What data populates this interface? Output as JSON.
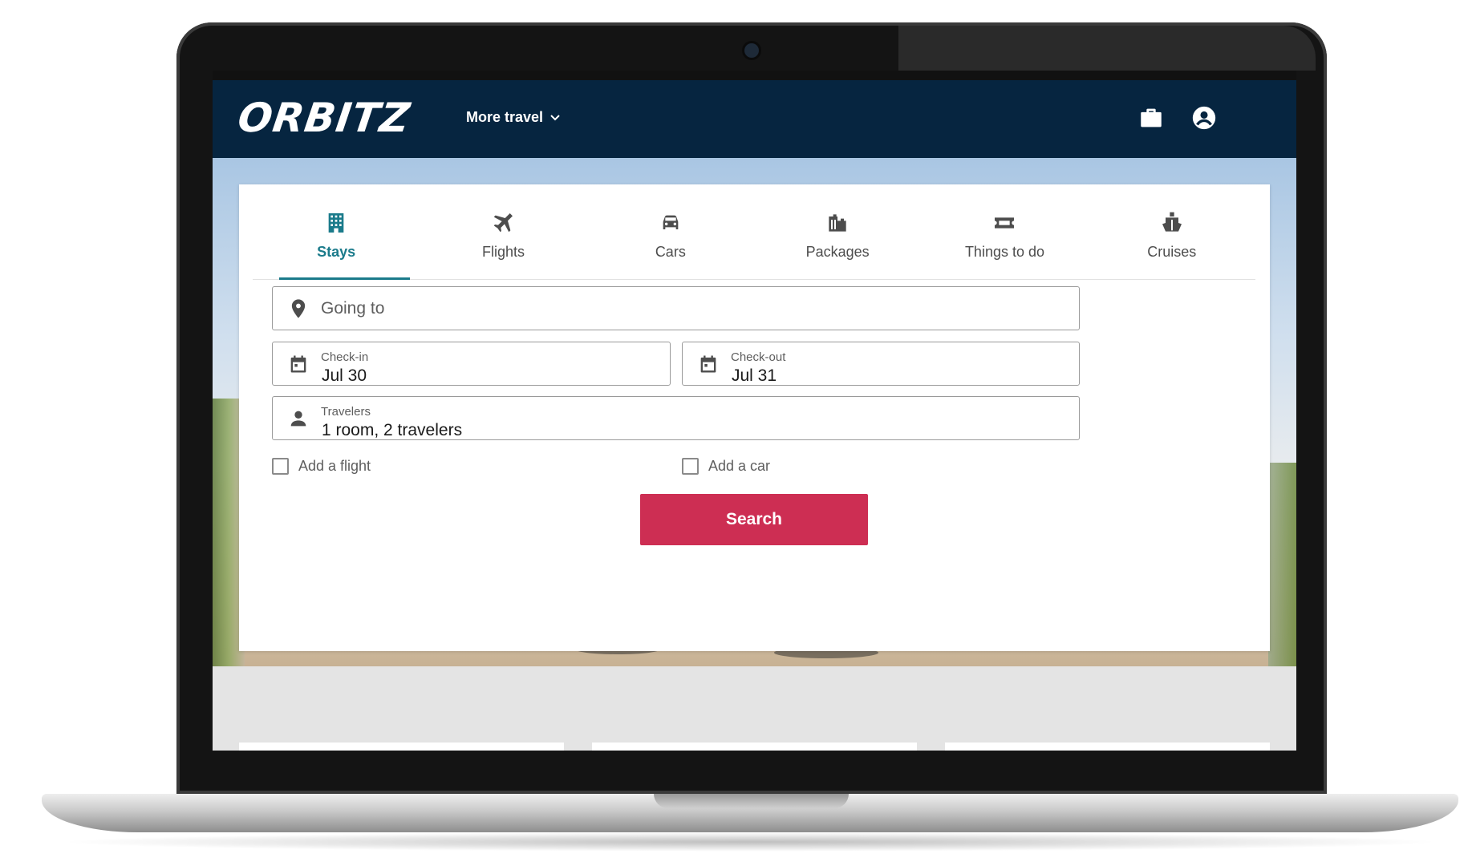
{
  "header": {
    "logo_text": "ORBITZ",
    "more_travel_label": "More travel",
    "icons": [
      "briefcase-icon",
      "account-icon"
    ],
    "background_color": "#062540"
  },
  "tabs": [
    {
      "label": "Stays",
      "icon": "hotel-building-icon",
      "active": true
    },
    {
      "label": "Flights",
      "icon": "airplane-icon",
      "active": false
    },
    {
      "label": "Cars",
      "icon": "car-icon",
      "active": false
    },
    {
      "label": "Packages",
      "icon": "luggage-icon",
      "active": false
    },
    {
      "label": "Things to do",
      "icon": "ticket-icon",
      "active": false
    },
    {
      "label": "Cruises",
      "icon": "ship-icon",
      "active": false
    }
  ],
  "form": {
    "destination": {
      "placeholder": "Going to",
      "icon": "map-pin-icon"
    },
    "check_in": {
      "label": "Check-in",
      "value": "Jul 30",
      "icon": "calendar-icon"
    },
    "check_out": {
      "label": "Check-out",
      "value": "Jul 31",
      "icon": "calendar-icon"
    },
    "travelers": {
      "label": "Travelers",
      "value": "1 room, 2 travelers",
      "icon": "person-icon"
    },
    "add_flight_label": "Add a flight",
    "add_flight_checked": false,
    "add_car_label": "Add a car",
    "add_car_checked": false,
    "search_label": "Search"
  },
  "colors": {
    "accent": "#1b7b8b",
    "search_button": "#cd2e53",
    "header": "#062540"
  }
}
